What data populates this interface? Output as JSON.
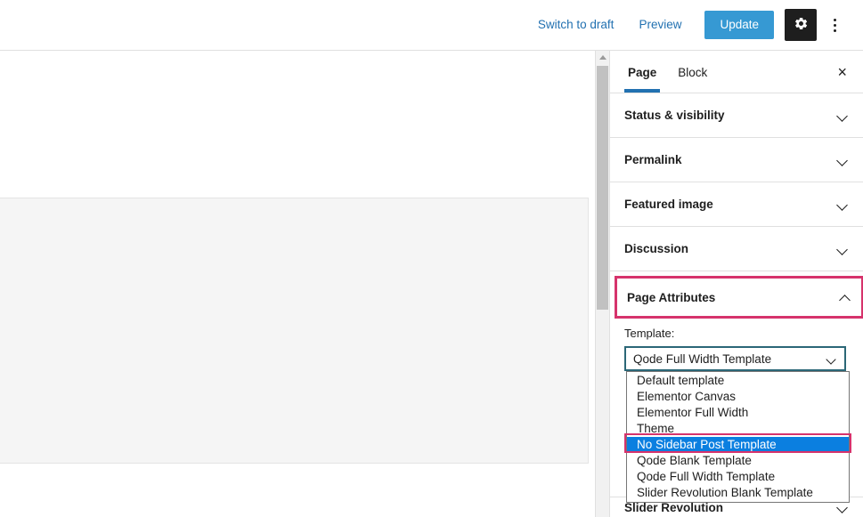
{
  "topbar": {
    "switch_to_draft": "Switch to draft",
    "preview": "Preview",
    "update": "Update",
    "settings_icon": "gear-icon",
    "more_icon": "more-vertical-icon",
    "accent_color": "#3699d3"
  },
  "sidebar": {
    "tabs": [
      {
        "label": "Page",
        "active": true
      },
      {
        "label": "Block",
        "active": false
      }
    ],
    "close_label": "×",
    "panels": [
      {
        "label": "Status & visibility",
        "expanded": false
      },
      {
        "label": "Permalink",
        "expanded": false
      },
      {
        "label": "Featured image",
        "expanded": false
      },
      {
        "label": "Discussion",
        "expanded": false
      }
    ],
    "page_attributes": {
      "label": "Page Attributes",
      "expanded": true,
      "highlight_color": "#d6336c",
      "template_label": "Template:",
      "template_value": "Qode Full Width Template",
      "select_border_color": "#2b6777"
    },
    "bottom_panel": {
      "label": "Slider Revolution",
      "expanded": false
    }
  },
  "dropdown": {
    "open": true,
    "selected_index": 4,
    "selected_bg": "#0b7fe0",
    "highlight_color": "#d6336c",
    "options": [
      "Default template",
      "Elementor Canvas",
      "Elementor Full Width",
      "Theme",
      "No Sidebar Post Template",
      "Qode Blank Template",
      "Qode Full Width Template",
      "Slider Revolution Blank Template"
    ]
  },
  "scrollbar": {
    "up_arrow_icon": "triangle-up-icon"
  }
}
